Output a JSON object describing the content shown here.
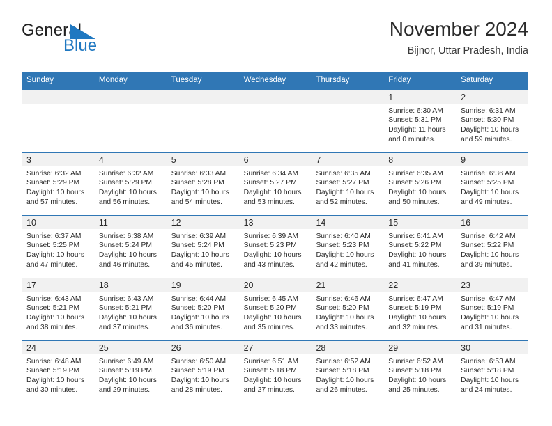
{
  "logo": {
    "word1": "General",
    "word2": "Blue",
    "triangle_color": "#1F78C1",
    "text_color": "#222222"
  },
  "header": {
    "title": "November 2024",
    "subtitle": "Bijnor, Uttar Pradesh, India"
  },
  "colors": {
    "header_blue": "#3077B5",
    "day_number_strip": "#F1F1F1",
    "cell_background": "#FFFFFF",
    "text": "#2B2B2B"
  },
  "weekday_headers": [
    "Sunday",
    "Monday",
    "Tuesday",
    "Wednesday",
    "Thursday",
    "Friday",
    "Saturday"
  ],
  "weeks": [
    [
      {
        "day": "",
        "sunrise": "",
        "sunset": "",
        "daylight": "",
        "empty": true
      },
      {
        "day": "",
        "sunrise": "",
        "sunset": "",
        "daylight": "",
        "empty": true
      },
      {
        "day": "",
        "sunrise": "",
        "sunset": "",
        "daylight": "",
        "empty": true
      },
      {
        "day": "",
        "sunrise": "",
        "sunset": "",
        "daylight": "",
        "empty": true
      },
      {
        "day": "",
        "sunrise": "",
        "sunset": "",
        "daylight": "",
        "empty": true
      },
      {
        "day": "1",
        "sunrise": "Sunrise: 6:30 AM",
        "sunset": "Sunset: 5:31 PM",
        "daylight": "Daylight: 11 hours and 0 minutes.",
        "empty": false
      },
      {
        "day": "2",
        "sunrise": "Sunrise: 6:31 AM",
        "sunset": "Sunset: 5:30 PM",
        "daylight": "Daylight: 10 hours and 59 minutes.",
        "empty": false
      }
    ],
    [
      {
        "day": "3",
        "sunrise": "Sunrise: 6:32 AM",
        "sunset": "Sunset: 5:29 PM",
        "daylight": "Daylight: 10 hours and 57 minutes.",
        "empty": false
      },
      {
        "day": "4",
        "sunrise": "Sunrise: 6:32 AM",
        "sunset": "Sunset: 5:29 PM",
        "daylight": "Daylight: 10 hours and 56 minutes.",
        "empty": false
      },
      {
        "day": "5",
        "sunrise": "Sunrise: 6:33 AM",
        "sunset": "Sunset: 5:28 PM",
        "daylight": "Daylight: 10 hours and 54 minutes.",
        "empty": false
      },
      {
        "day": "6",
        "sunrise": "Sunrise: 6:34 AM",
        "sunset": "Sunset: 5:27 PM",
        "daylight": "Daylight: 10 hours and 53 minutes.",
        "empty": false
      },
      {
        "day": "7",
        "sunrise": "Sunrise: 6:35 AM",
        "sunset": "Sunset: 5:27 PM",
        "daylight": "Daylight: 10 hours and 52 minutes.",
        "empty": false
      },
      {
        "day": "8",
        "sunrise": "Sunrise: 6:35 AM",
        "sunset": "Sunset: 5:26 PM",
        "daylight": "Daylight: 10 hours and 50 minutes.",
        "empty": false
      },
      {
        "day": "9",
        "sunrise": "Sunrise: 6:36 AM",
        "sunset": "Sunset: 5:25 PM",
        "daylight": "Daylight: 10 hours and 49 minutes.",
        "empty": false
      }
    ],
    [
      {
        "day": "10",
        "sunrise": "Sunrise: 6:37 AM",
        "sunset": "Sunset: 5:25 PM",
        "daylight": "Daylight: 10 hours and 47 minutes.",
        "empty": false
      },
      {
        "day": "11",
        "sunrise": "Sunrise: 6:38 AM",
        "sunset": "Sunset: 5:24 PM",
        "daylight": "Daylight: 10 hours and 46 minutes.",
        "empty": false
      },
      {
        "day": "12",
        "sunrise": "Sunrise: 6:39 AM",
        "sunset": "Sunset: 5:24 PM",
        "daylight": "Daylight: 10 hours and 45 minutes.",
        "empty": false
      },
      {
        "day": "13",
        "sunrise": "Sunrise: 6:39 AM",
        "sunset": "Sunset: 5:23 PM",
        "daylight": "Daylight: 10 hours and 43 minutes.",
        "empty": false
      },
      {
        "day": "14",
        "sunrise": "Sunrise: 6:40 AM",
        "sunset": "Sunset: 5:23 PM",
        "daylight": "Daylight: 10 hours and 42 minutes.",
        "empty": false
      },
      {
        "day": "15",
        "sunrise": "Sunrise: 6:41 AM",
        "sunset": "Sunset: 5:22 PM",
        "daylight": "Daylight: 10 hours and 41 minutes.",
        "empty": false
      },
      {
        "day": "16",
        "sunrise": "Sunrise: 6:42 AM",
        "sunset": "Sunset: 5:22 PM",
        "daylight": "Daylight: 10 hours and 39 minutes.",
        "empty": false
      }
    ],
    [
      {
        "day": "17",
        "sunrise": "Sunrise: 6:43 AM",
        "sunset": "Sunset: 5:21 PM",
        "daylight": "Daylight: 10 hours and 38 minutes.",
        "empty": false
      },
      {
        "day": "18",
        "sunrise": "Sunrise: 6:43 AM",
        "sunset": "Sunset: 5:21 PM",
        "daylight": "Daylight: 10 hours and 37 minutes.",
        "empty": false
      },
      {
        "day": "19",
        "sunrise": "Sunrise: 6:44 AM",
        "sunset": "Sunset: 5:20 PM",
        "daylight": "Daylight: 10 hours and 36 minutes.",
        "empty": false
      },
      {
        "day": "20",
        "sunrise": "Sunrise: 6:45 AM",
        "sunset": "Sunset: 5:20 PM",
        "daylight": "Daylight: 10 hours and 35 minutes.",
        "empty": false
      },
      {
        "day": "21",
        "sunrise": "Sunrise: 6:46 AM",
        "sunset": "Sunset: 5:20 PM",
        "daylight": "Daylight: 10 hours and 33 minutes.",
        "empty": false
      },
      {
        "day": "22",
        "sunrise": "Sunrise: 6:47 AM",
        "sunset": "Sunset: 5:19 PM",
        "daylight": "Daylight: 10 hours and 32 minutes.",
        "empty": false
      },
      {
        "day": "23",
        "sunrise": "Sunrise: 6:47 AM",
        "sunset": "Sunset: 5:19 PM",
        "daylight": "Daylight: 10 hours and 31 minutes.",
        "empty": false
      }
    ],
    [
      {
        "day": "24",
        "sunrise": "Sunrise: 6:48 AM",
        "sunset": "Sunset: 5:19 PM",
        "daylight": "Daylight: 10 hours and 30 minutes.",
        "empty": false
      },
      {
        "day": "25",
        "sunrise": "Sunrise: 6:49 AM",
        "sunset": "Sunset: 5:19 PM",
        "daylight": "Daylight: 10 hours and 29 minutes.",
        "empty": false
      },
      {
        "day": "26",
        "sunrise": "Sunrise: 6:50 AM",
        "sunset": "Sunset: 5:19 PM",
        "daylight": "Daylight: 10 hours and 28 minutes.",
        "empty": false
      },
      {
        "day": "27",
        "sunrise": "Sunrise: 6:51 AM",
        "sunset": "Sunset: 5:18 PM",
        "daylight": "Daylight: 10 hours and 27 minutes.",
        "empty": false
      },
      {
        "day": "28",
        "sunrise": "Sunrise: 6:52 AM",
        "sunset": "Sunset: 5:18 PM",
        "daylight": "Daylight: 10 hours and 26 minutes.",
        "empty": false
      },
      {
        "day": "29",
        "sunrise": "Sunrise: 6:52 AM",
        "sunset": "Sunset: 5:18 PM",
        "daylight": "Daylight: 10 hours and 25 minutes.",
        "empty": false
      },
      {
        "day": "30",
        "sunrise": "Sunrise: 6:53 AM",
        "sunset": "Sunset: 5:18 PM",
        "daylight": "Daylight: 10 hours and 24 minutes.",
        "empty": false
      }
    ]
  ]
}
